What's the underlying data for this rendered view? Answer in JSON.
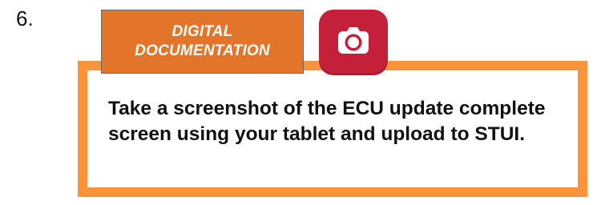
{
  "step": {
    "number": "6."
  },
  "tag": {
    "line1": "DIGITAL",
    "line2": "DOCUMENTATION"
  },
  "instruction": {
    "text": "Take a screenshot of the ECU update complete screen using your tablet and upload to STUI."
  },
  "icons": {
    "camera": "camera-icon"
  },
  "colors": {
    "frame_border": "#F7943C",
    "tag_background": "#E3752B",
    "camera_badge": "#C4203A",
    "text": "#111111"
  }
}
